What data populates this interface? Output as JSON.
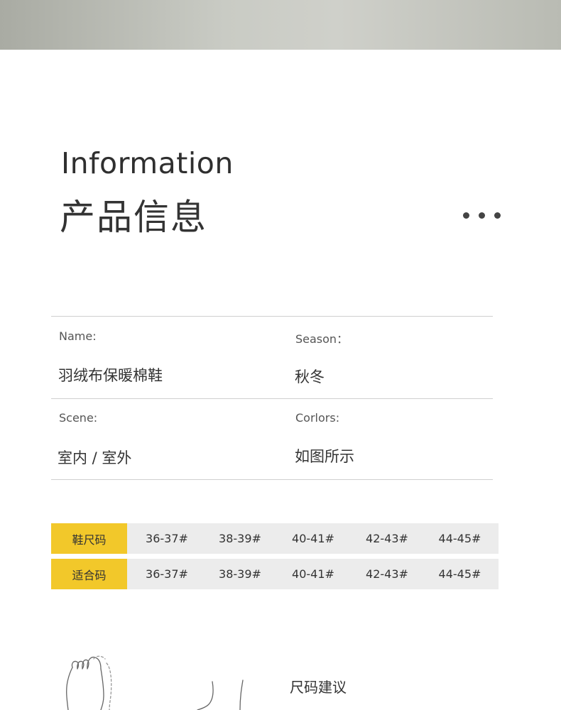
{
  "header": {
    "title_en": "Information",
    "title_cn": "产品信息"
  },
  "info": {
    "name_label": "Name:",
    "name_value": "羽绒布保暖棉鞋",
    "season_label": "Season：",
    "season_value": "秋冬",
    "scene_label": "Scene:",
    "scene_value": "室内 / 室外",
    "colors_label": "Corlors:",
    "colors_value": "如图所示"
  },
  "size_table": {
    "rows": [
      {
        "label": "鞋尺码",
        "cells": [
          "36-37#",
          "38-39#",
          "40-41#",
          "42-43#",
          "44-45#"
        ]
      },
      {
        "label": "适合码",
        "cells": [
          "36-37#",
          "38-39#",
          "40-41#",
          "42-43#",
          "44-45#"
        ]
      }
    ]
  },
  "advice": {
    "title": "尺码建议"
  },
  "colors": {
    "accent": "#f2c82a",
    "row_bg": "#ececec",
    "divider": "#cfcfcf"
  }
}
